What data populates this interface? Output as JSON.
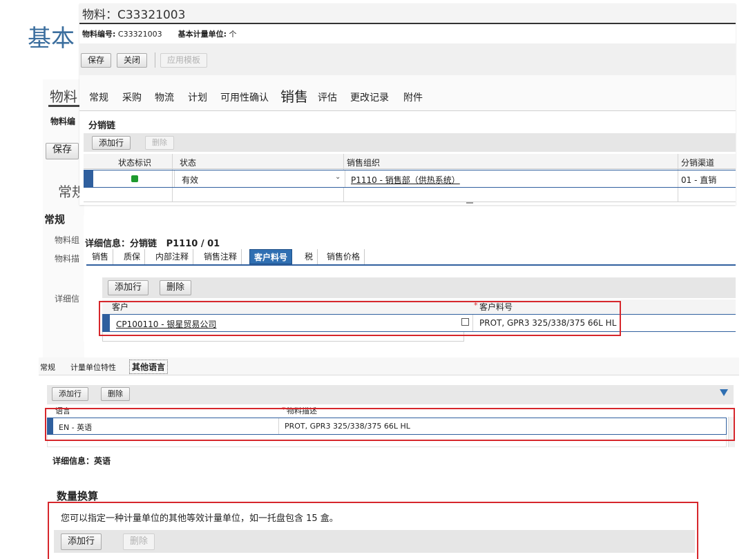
{
  "background": {
    "title_frag": "基本",
    "left_labels": [
      "物料",
      "物料编",
      "保存",
      "常规",
      "常规",
      "物料组",
      "物料描",
      "详细信"
    ]
  },
  "layer1": {
    "title": "物料：C33321003",
    "material_no_label": "物料编号:",
    "material_no": "C33321003",
    "base_uom_label": "基本计量单位:",
    "base_uom": "个",
    "buttons": {
      "save": "保存",
      "close": "关闭",
      "apply_template": "应用模板"
    },
    "tabs": [
      "常规",
      "采购",
      "物流",
      "计划",
      "可用性确认",
      "销售",
      "评估",
      "更改记录",
      "附件"
    ],
    "active_tab": "销售",
    "section_title": "分销链",
    "add_row": "添加行",
    "delete": "删除",
    "columns": [
      "状态标识",
      "状态",
      "销售组织",
      "分销渠道"
    ],
    "row": {
      "status": "有效",
      "sales_org": "P1110 - 销售部（供热系统）",
      "channel": "01 - 直销"
    }
  },
  "layer2": {
    "detail_title": "详细信息：分销链   P1110 / 01",
    "tabs": [
      "销售",
      "质保",
      "内部注释",
      "销售注释",
      "客户料号",
      "税",
      "销售价格"
    ],
    "active_tab": "客户料号",
    "add_row": "添加行",
    "delete": "删除",
    "col_customer": "客户",
    "col_customer_mat": "客户料号",
    "row": {
      "customer": "CP100110 - 银星贸易公司",
      "customer_mat": "PROT, GPR3 325/338/375 66L HL"
    }
  },
  "layer3": {
    "tabs": [
      "常规",
      "计量单位特性",
      "其他语言"
    ],
    "active_tab": "其他语言",
    "add_row": "添加行",
    "delete": "删除",
    "col_language": "语言",
    "col_desc": "物料描述",
    "row": {
      "language": "EN - 英语",
      "desc": "PROT, GPR3 325/338/375 66L HL"
    },
    "detail": "详细信息：英语"
  },
  "layer4": {
    "title": "数量换算",
    "info": "您可以指定一种计量单位的其他等效计量单位，如一托盘包含 15 盒。",
    "add_row": "添加行",
    "delete": "删除"
  },
  "colors": {
    "accent_blue": "#2f5f9e",
    "highlight_red": "#d6262b",
    "status_green": "#1e9a2e",
    "title_blue": "#3b6e9e"
  }
}
